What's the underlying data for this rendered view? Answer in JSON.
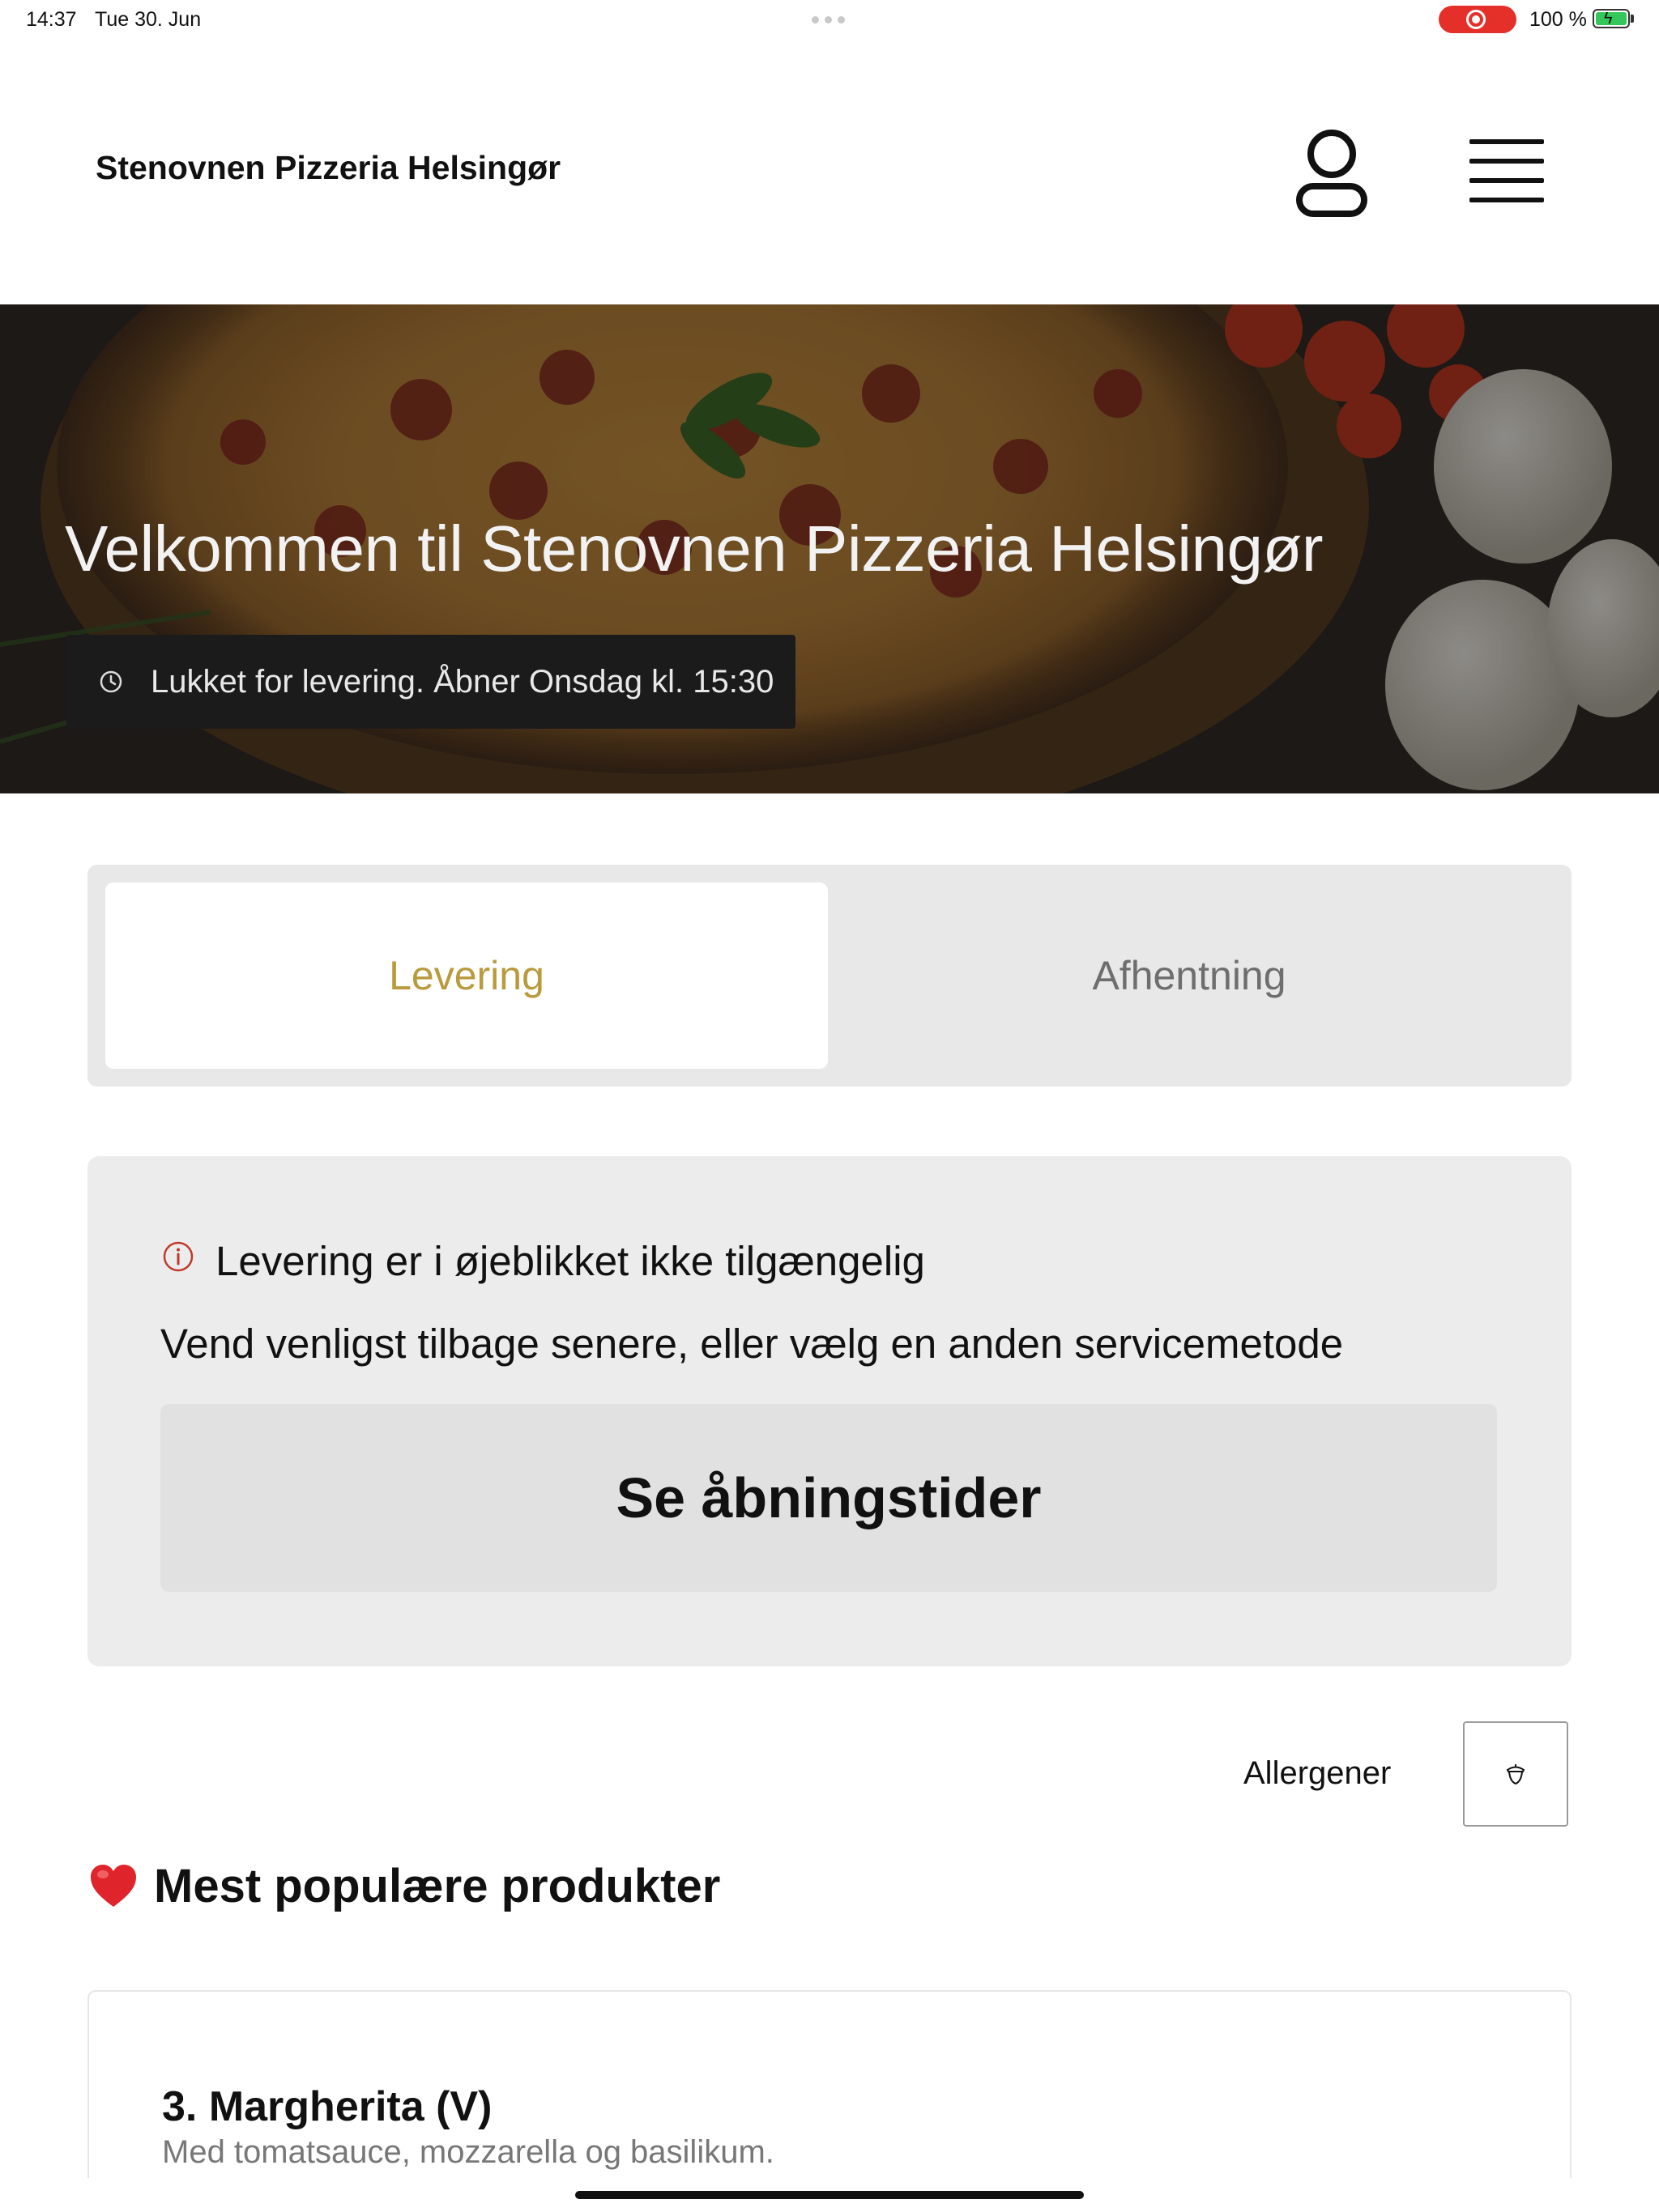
{
  "status_bar": {
    "time": "14:37",
    "date": "Tue 30. Jun",
    "battery": "100 %",
    "battery_level": 1.0,
    "recording_color": "#e5302a"
  },
  "header": {
    "brand": "Stenovnen Pizzeria Helsingør",
    "user_icon": "user-icon",
    "menu_icon": "hamburger-menu-icon"
  },
  "hero": {
    "title": "Velkommen til Stenovnen Pizzeria Helsingør",
    "status_text": "Lukket for levering. Åbner Onsdag kl. 15:30",
    "status_icon": "clock-icon"
  },
  "tabs": [
    {
      "label": "Levering",
      "active": true
    },
    {
      "label": "Afhentning",
      "active": false
    }
  ],
  "notice": {
    "icon": "info-icon",
    "title": "Levering er i øjeblikket ikke tilgængelig",
    "text": "Vend venligst tilbage senere, eller vælg en anden servicemetode",
    "button_label": "Se åbningstider"
  },
  "allergens": {
    "label": "Allergener",
    "icon": "acorn-icon"
  },
  "popular": {
    "title": "Mest populære produkter",
    "icon": "heart-icon",
    "products": [
      {
        "name": "3. Margherita (V)",
        "description": "Med tomatsauce, mozzarella og basilikum."
      }
    ]
  },
  "colors": {
    "accent": "#b99a3c",
    "tab_bg": "#e8e8e8",
    "notice_bg": "#ececec",
    "alert_red": "#c0392b"
  }
}
